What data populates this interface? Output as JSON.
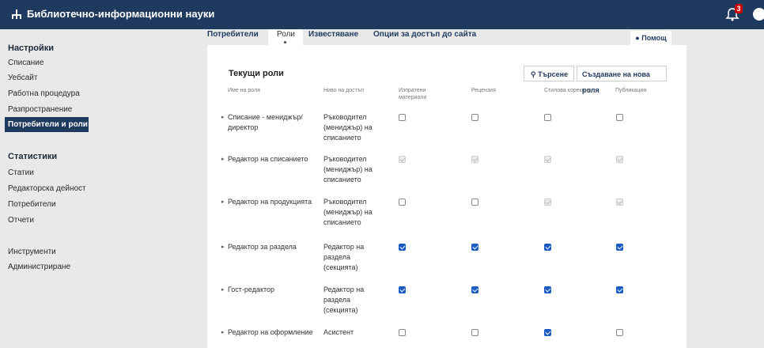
{
  "app": {
    "title": "Библиотечно-информационни науки",
    "notification_count": "3"
  },
  "sidebar": {
    "settings_heading": "Настройки",
    "settings_items": [
      "Списание",
      "Уебсайт",
      "Работна процедура",
      "Разпространение",
      "Потребители и роли"
    ],
    "stats_heading": "Статистики",
    "stats_items": [
      "Статии",
      "Редакторска дейност",
      "Потребители",
      "Отчети"
    ],
    "other_items": [
      "Инструменти",
      "Администриране"
    ]
  },
  "tabs": [
    "Потребители",
    "Роли",
    "Известяване",
    "Опции за достъп до сайта"
  ],
  "help_label": "Помощ",
  "panel": {
    "title": "Текущи роли",
    "search_label": "Търсене",
    "create_label": "Създаване на нова роля",
    "columns": [
      "Име на роля",
      "Ниво на достъп",
      "Изпратени материали",
      "Рецензия",
      "Стилова корекция",
      "Публикация"
    ]
  },
  "roles": [
    {
      "name": "Списание - мениджър/директор",
      "level": "Ръководител (мениджър) на списанието",
      "flags": [
        "off",
        "off",
        "off",
        "off"
      ]
    },
    {
      "name": "Редактор на списанието",
      "level": "Ръководител (мениджър) на списанието",
      "flags": [
        "dis",
        "dis",
        "dis",
        "dis"
      ]
    },
    {
      "name": "Редактор на продукцията",
      "level": "Ръководител (мениджър) на списанието",
      "flags": [
        "off",
        "off",
        "dis",
        "dis"
      ]
    },
    {
      "name": "Редактор за раздела",
      "level": "Редактор на раздела (секцията)",
      "flags": [
        "on",
        "on",
        "on",
        "on"
      ]
    },
    {
      "name": "Гост-редактор",
      "level": "Редактор на раздела (секцията)",
      "flags": [
        "on",
        "on",
        "on",
        "on"
      ]
    },
    {
      "name": "Редактор на оформление",
      "level": "Асистент",
      "flags": [
        "off",
        "off",
        "on",
        "off"
      ]
    }
  ]
}
